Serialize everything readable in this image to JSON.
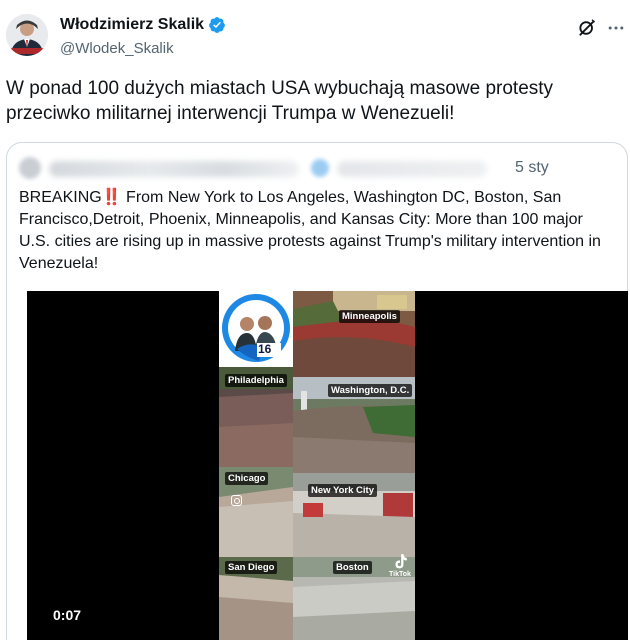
{
  "author": {
    "name": "Włodzimierz Skalik",
    "handle": "@Wlodek_Skalik",
    "verified": true,
    "verified_color": "#1d9bf0"
  },
  "icons": {
    "grok": "grok-icon",
    "more": "more-icon",
    "verified": "verified-badge-icon"
  },
  "tweet": {
    "text": "W ponad 100 dużych miastach USA wybuchają masowe protesty przeciwko militarnej interwencji Trumpa w Wenezueli!"
  },
  "quote": {
    "date": "5 sty",
    "prefix": "BREAKING",
    "emoji": "‼️",
    "body": " From New York to Los Angeles, Washington DC, Boston, San Francisco,Detroit, Phoenix, Minneapolis, and Kansas City: More than 100 major U.S. cities are rising up in massive protests against Trump's military intervention in Venezuela!"
  },
  "video": {
    "timestamp": "0:07",
    "logo_number": "16",
    "watermark": "TikTok",
    "tiles": [
      {
        "label": "Minneapolis"
      },
      {
        "label": "Philadelphia"
      },
      {
        "label": "Washington, D.C."
      },
      {
        "label": "Chicago"
      },
      {
        "label": "New York City"
      },
      {
        "label": "San Diego"
      },
      {
        "label": "Boston"
      }
    ]
  }
}
